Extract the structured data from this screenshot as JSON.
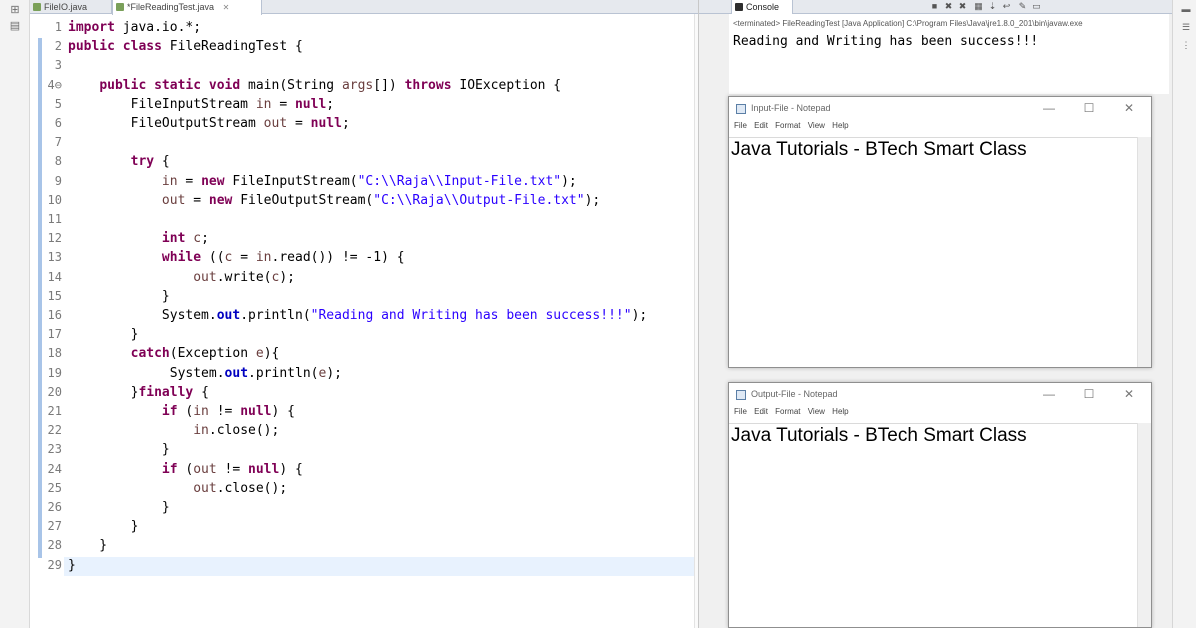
{
  "editor": {
    "tabs": [
      {
        "label": "FileIO.java",
        "active": false
      },
      {
        "label": "*FileReadingTest.java",
        "active": true
      }
    ],
    "line_numbers": [
      "1",
      "2",
      "3",
      "4⊖",
      "5",
      "6",
      "7",
      "8",
      "9",
      "10",
      "11",
      "12",
      "13",
      "14",
      "15",
      "16",
      "17",
      "18",
      "19",
      "20",
      "21",
      "22",
      "23",
      "24",
      "25",
      "26",
      "27",
      "28",
      "29"
    ],
    "lines": [
      [
        {
          "t": "import",
          "c": "kw"
        },
        {
          "t": " java.io.*;"
        }
      ],
      [
        {
          "t": "public class",
          "c": "kw"
        },
        {
          "t": " FileReadingTest {"
        }
      ],
      [],
      [
        {
          "t": "    "
        },
        {
          "t": "public static void",
          "c": "kw"
        },
        {
          "t": " main(String "
        },
        {
          "t": "args",
          "c": "par"
        },
        {
          "t": "[]) "
        },
        {
          "t": "throws",
          "c": "kw"
        },
        {
          "t": " IOException {"
        }
      ],
      [
        {
          "t": "        FileInputStream "
        },
        {
          "t": "in",
          "c": "par"
        },
        {
          "t": " = "
        },
        {
          "t": "null",
          "c": "kw"
        },
        {
          "t": ";"
        }
      ],
      [
        {
          "t": "        FileOutputStream "
        },
        {
          "t": "out",
          "c": "par"
        },
        {
          "t": " = "
        },
        {
          "t": "null",
          "c": "kw"
        },
        {
          "t": ";"
        }
      ],
      [],
      [
        {
          "t": "        "
        },
        {
          "t": "try",
          "c": "kw"
        },
        {
          "t": " {"
        }
      ],
      [
        {
          "t": "            "
        },
        {
          "t": "in",
          "c": "par"
        },
        {
          "t": " = "
        },
        {
          "t": "new",
          "c": "kw"
        },
        {
          "t": " FileInputStream("
        },
        {
          "t": "\"C:\\\\Raja\\\\Input-File.txt\"",
          "c": "str"
        },
        {
          "t": ");"
        }
      ],
      [
        {
          "t": "            "
        },
        {
          "t": "out",
          "c": "par"
        },
        {
          "t": " = "
        },
        {
          "t": "new",
          "c": "kw"
        },
        {
          "t": " FileOutputStream("
        },
        {
          "t": "\"C:\\\\Raja\\\\Output-File.txt\"",
          "c": "str"
        },
        {
          "t": ");"
        }
      ],
      [],
      [
        {
          "t": "            "
        },
        {
          "t": "int",
          "c": "kw"
        },
        {
          "t": " "
        },
        {
          "t": "c",
          "c": "par"
        },
        {
          "t": ";"
        }
      ],
      [
        {
          "t": "            "
        },
        {
          "t": "while",
          "c": "kw"
        },
        {
          "t": " (("
        },
        {
          "t": "c",
          "c": "par"
        },
        {
          "t": " = "
        },
        {
          "t": "in",
          "c": "par"
        },
        {
          "t": ".read()) != -1) {"
        }
      ],
      [
        {
          "t": "                "
        },
        {
          "t": "out",
          "c": "par"
        },
        {
          "t": ".write("
        },
        {
          "t": "c",
          "c": "par"
        },
        {
          "t": ");"
        }
      ],
      [
        {
          "t": "            }"
        }
      ],
      [
        {
          "t": "            System."
        },
        {
          "t": "out",
          "c": "fld"
        },
        {
          "t": ".println("
        },
        {
          "t": "\"Reading and Writing has been success!!!\"",
          "c": "str"
        },
        {
          "t": ");"
        }
      ],
      [
        {
          "t": "        }"
        }
      ],
      [
        {
          "t": "        "
        },
        {
          "t": "catch",
          "c": "kw"
        },
        {
          "t": "(Exception "
        },
        {
          "t": "e",
          "c": "par"
        },
        {
          "t": "){"
        }
      ],
      [
        {
          "t": "             System."
        },
        {
          "t": "out",
          "c": "fld"
        },
        {
          "t": ".println("
        },
        {
          "t": "e",
          "c": "par"
        },
        {
          "t": ");"
        }
      ],
      [
        {
          "t": "        }"
        },
        {
          "t": "finally",
          "c": "kw"
        },
        {
          "t": " {"
        }
      ],
      [
        {
          "t": "            "
        },
        {
          "t": "if",
          "c": "kw"
        },
        {
          "t": " ("
        },
        {
          "t": "in",
          "c": "par"
        },
        {
          "t": " != "
        },
        {
          "t": "null",
          "c": "kw"
        },
        {
          "t": ") {"
        }
      ],
      [
        {
          "t": "                "
        },
        {
          "t": "in",
          "c": "par"
        },
        {
          "t": ".close();"
        }
      ],
      [
        {
          "t": "            }"
        }
      ],
      [
        {
          "t": "            "
        },
        {
          "t": "if",
          "c": "kw"
        },
        {
          "t": " ("
        },
        {
          "t": "out",
          "c": "par"
        },
        {
          "t": " != "
        },
        {
          "t": "null",
          "c": "kw"
        },
        {
          "t": ") {"
        }
      ],
      [
        {
          "t": "                "
        },
        {
          "t": "out",
          "c": "par"
        },
        {
          "t": ".close();"
        }
      ],
      [
        {
          "t": "            }"
        }
      ],
      [
        {
          "t": "        }"
        }
      ],
      [
        {
          "t": "    }"
        }
      ],
      [
        {
          "t": "}"
        }
      ]
    ]
  },
  "console": {
    "tab_label": "Console",
    "status": "<terminated> FileReadingTest [Java Application] C:\\Program Files\\Java\\jre1.8.0_201\\bin\\javaw.exe",
    "output": "Reading and Writing has been success!!!"
  },
  "notepads": [
    {
      "title": "Input-File - Notepad",
      "menu": [
        "File",
        "Edit",
        "Format",
        "View",
        "Help"
      ],
      "content": "Java Tutorials - BTech Smart Class"
    },
    {
      "title": "Output-File - Notepad",
      "menu": [
        "File",
        "Edit",
        "Format",
        "View",
        "Help"
      ],
      "content": "Java Tutorials - BTech Smart Class"
    }
  ],
  "window_buttons": {
    "minimize": "—",
    "maximize": "☐",
    "close": "✕"
  }
}
